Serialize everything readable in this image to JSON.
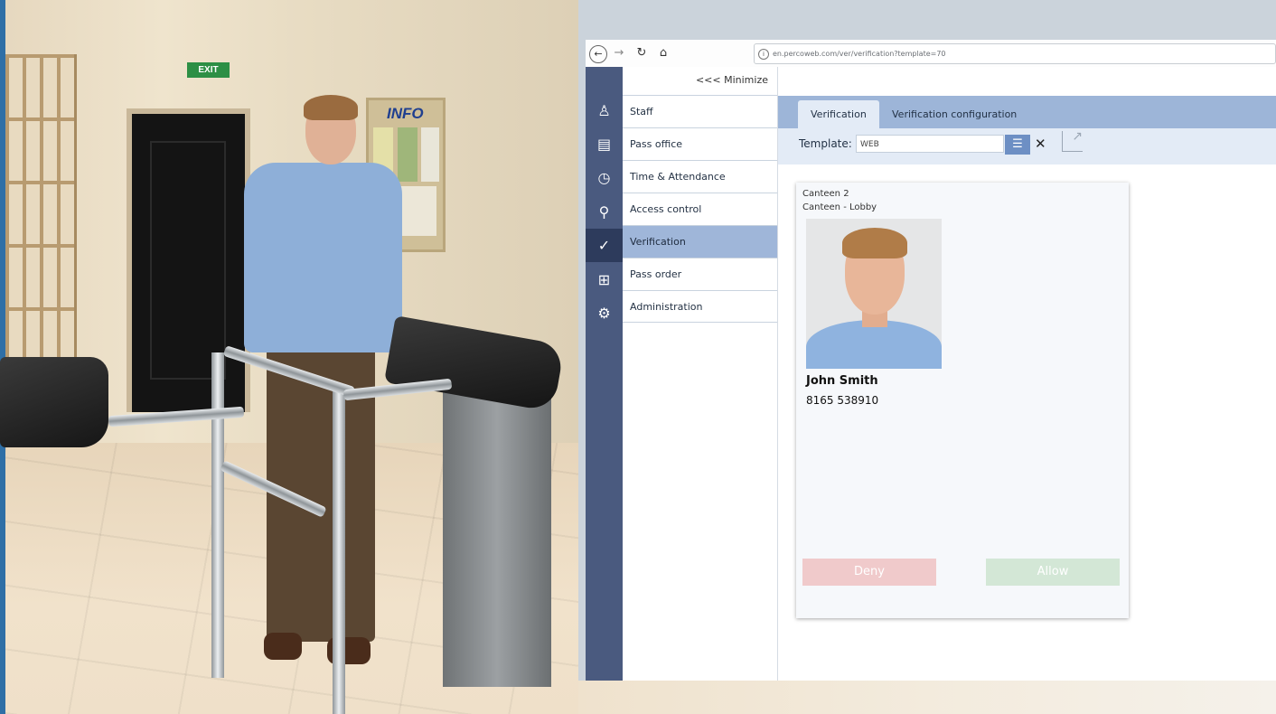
{
  "scene": {
    "exit_sign": "EXIT",
    "info_board": "INFO"
  },
  "browser": {
    "url": "en.percoweb.com/ver/verification?template=70"
  },
  "sidebar": {
    "minimize_label": "<<< Minimize",
    "items": [
      {
        "label": "Staff",
        "icon": "staff-icon",
        "active": false
      },
      {
        "label": "Pass office",
        "icon": "id-card-icon",
        "active": false
      },
      {
        "label": "Time & Attendance",
        "icon": "clock-user-icon",
        "active": false
      },
      {
        "label": "Access control",
        "icon": "key-icon",
        "active": false
      },
      {
        "label": "Verification",
        "icon": "user-check-icon",
        "active": true
      },
      {
        "label": "Pass order",
        "icon": "id-card-add-icon",
        "active": false
      },
      {
        "label": "Administration",
        "icon": "gear-icon",
        "active": false
      }
    ]
  },
  "tabs": [
    {
      "label": "Verification",
      "active": true
    },
    {
      "label": "Verification configuration",
      "active": false
    }
  ],
  "template": {
    "label": "Template:",
    "value": "WEB"
  },
  "card": {
    "location": "Canteen 2",
    "sublocation": "Canteen - Lobby",
    "person_name": "John Smith",
    "card_number": "8165 538910",
    "deny_label": "Deny",
    "allow_label": "Allow"
  },
  "colors": {
    "sidebar_icons_bg": "#4a5a7f",
    "active_menu": "#9fb6d9",
    "tabbar": "#9db5d8",
    "deny": "#f0cacb",
    "allow": "#d3e7d6"
  }
}
